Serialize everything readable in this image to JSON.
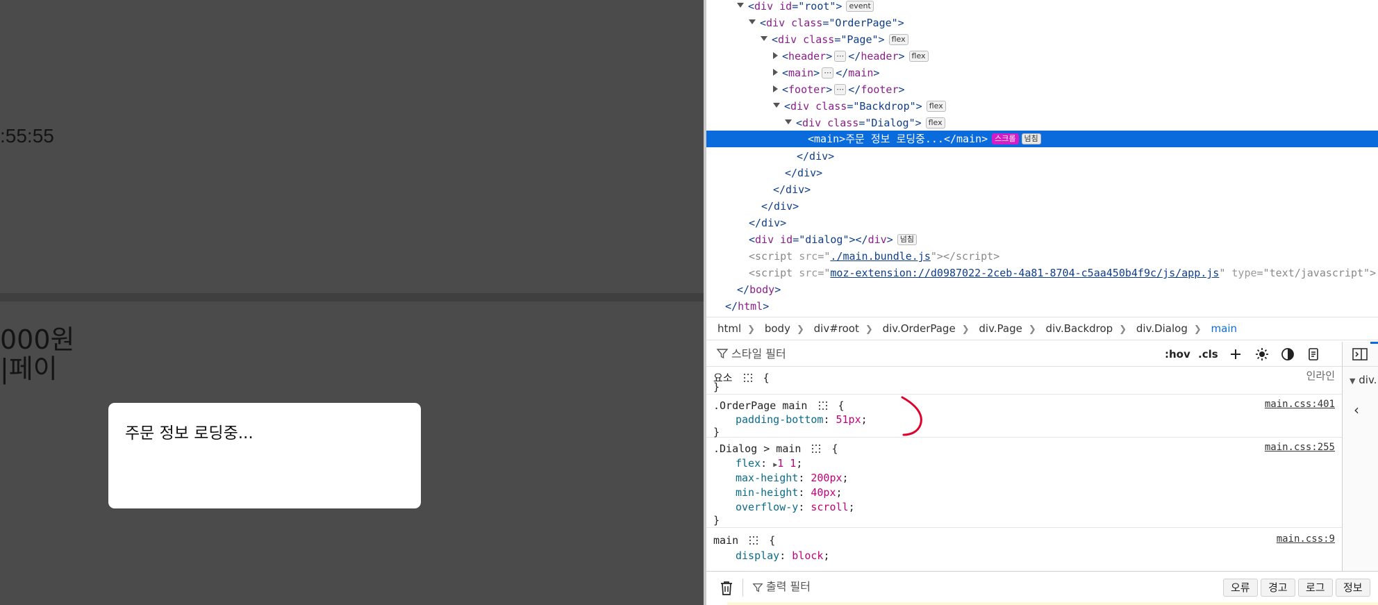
{
  "page": {
    "time_text": ":55:55",
    "price_text": "000원",
    "pay_text": "|페이",
    "dialog_text": "주문 정보 로딩중..."
  },
  "tree": {
    "line1_tag": "div",
    "line1_attr": "id",
    "line1_val": "root",
    "line1_badge": "event",
    "line2_tag": "div",
    "line2_attr": "class",
    "line2_val": "OrderPage",
    "line3_tag": "div",
    "line3_attr": "class",
    "line3_val": "Page",
    "line3_badge": "flex",
    "line4_tag": "header",
    "line4_badge": "flex",
    "line5_tag": "main",
    "line6_tag": "footer",
    "line7_tag": "div",
    "line7_attr": "class",
    "line7_val": "Backdrop",
    "line7_badge": "flex",
    "line8_tag": "div",
    "line8_attr": "class",
    "line8_val": "Dialog",
    "line8_badge": "flex",
    "line9_text": "주문 정보 로딩중...",
    "line9_tag": "main",
    "line9_badge_scroll": "스크롤",
    "line9_badge_overflow": "넘침",
    "dialog_div_id": "dialog",
    "dialog_div_badge": "넘침",
    "script1_src": "./main.bundle.js",
    "script2_src": "moz-extension://d0987022-2ceb-4a81-8704-c5aa450b4f9c/js/app.js",
    "script2_type": "text/javascript",
    "ellipsis": "⋯"
  },
  "breadcrumbs": [
    "html",
    "body",
    "div#root",
    "div.OrderPage",
    "div.Page",
    "div.Backdrop",
    "div.Dialog",
    "main"
  ],
  "toolbar": {
    "filter_label": "스타일 필터",
    "hov": ":hov",
    "cls": ".cls"
  },
  "rules": {
    "element_selector": "요소",
    "inline_label": "인라인",
    "r1_selector": ".OrderPage main",
    "r1_source": "main.css:401",
    "r1_p1_name": "padding-bottom",
    "r1_p1_val": "51px",
    "r2_selector": ".Dialog > main",
    "r2_source": "main.css:255",
    "r2_p1_name": "flex",
    "r2_p1_val": "1 1",
    "r2_p2_name": "max-height",
    "r2_p2_val": "200px",
    "r2_p3_name": "min-height",
    "r2_p3_val": "40px",
    "r2_p4_name": "overflow-y",
    "r2_p4_val": "scroll",
    "r3_selector": "main",
    "r3_source": "main.css:9",
    "r3_p1_name": "display",
    "r3_p1_val": "block",
    "side_label": "div."
  },
  "console": {
    "filter_label": "출력 필터",
    "levels": [
      "오류",
      "경고",
      "로그",
      "정보"
    ]
  },
  "colors": {
    "selection": "#0a6cdc",
    "backdrop": "#4b4b4b",
    "annotation": "#e0002a"
  }
}
